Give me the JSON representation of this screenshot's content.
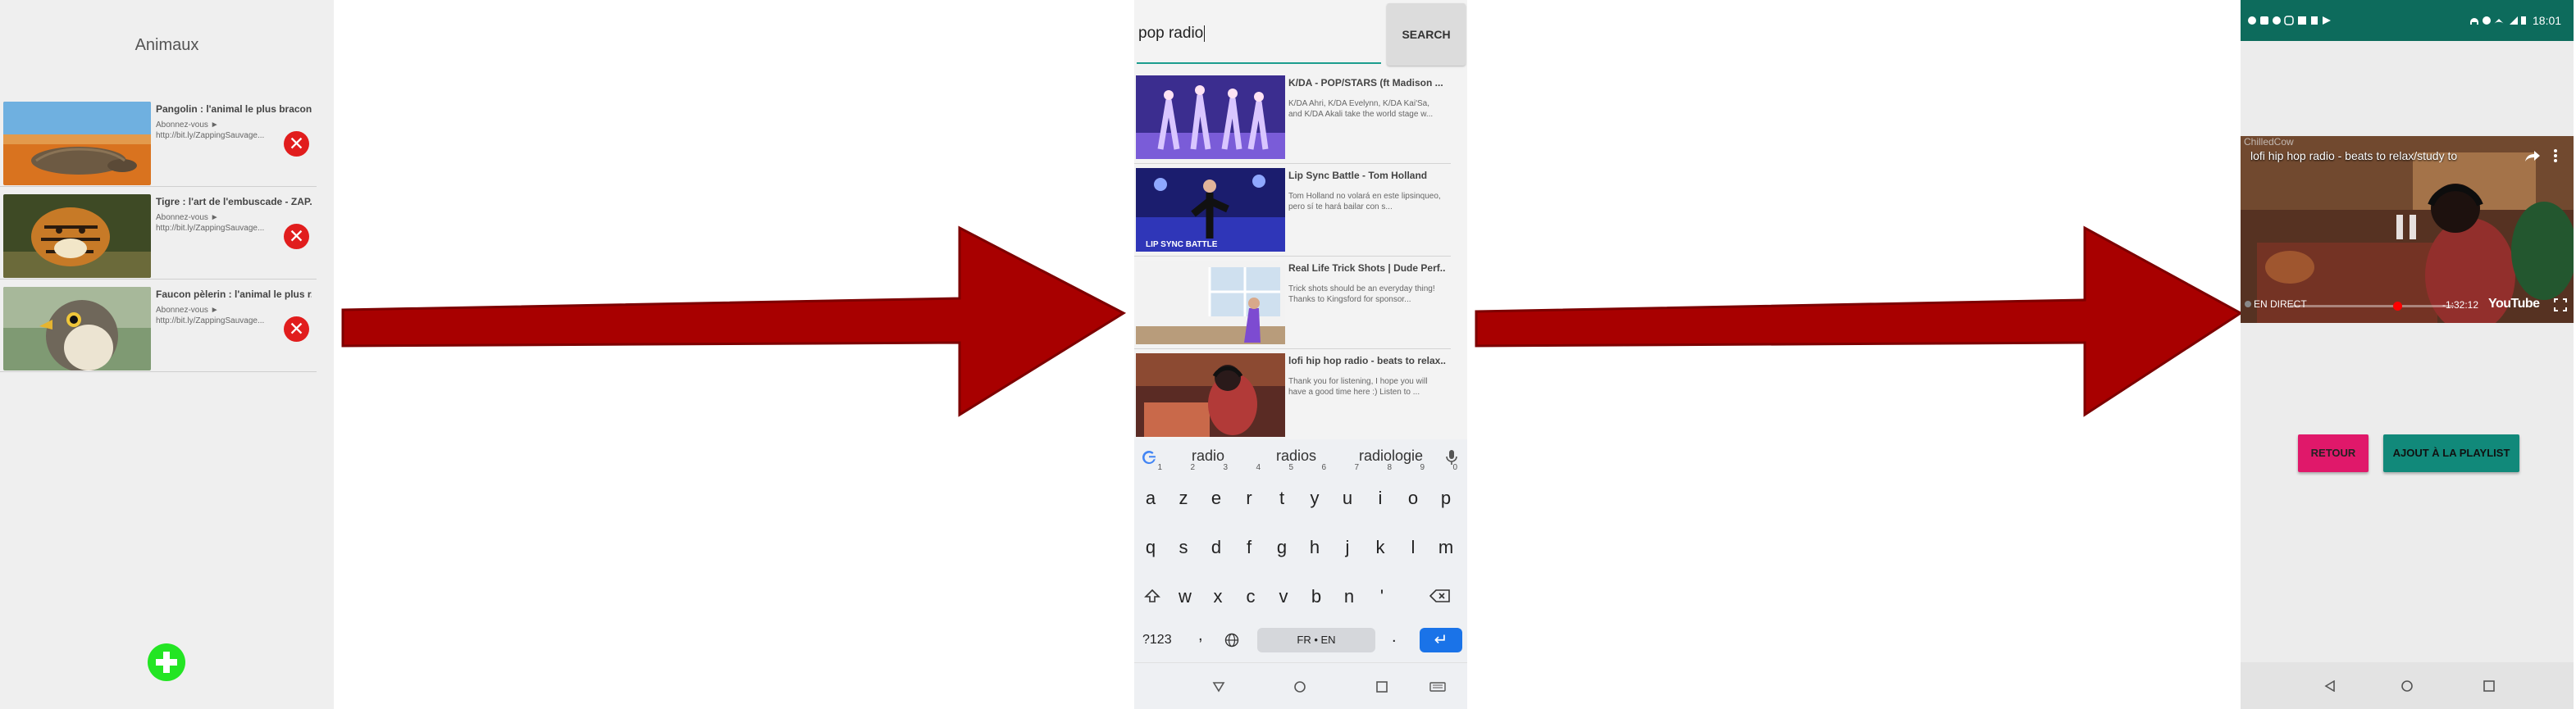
{
  "panel1": {
    "title": "Animaux",
    "videos": [
      {
        "title": "Pangolin : l'animal le plus bracon...",
        "desc": "Abonnez-vous ► http://bit.ly/ZappingSauvage..."
      },
      {
        "title": "Tigre : l'art de l'embuscade - ZAP...",
        "desc": "Abonnez-vous ► http://bit.ly/ZappingSauvage..."
      },
      {
        "title": "Faucon pèlerin : l'animal le plus r...",
        "desc": "Abonnez-vous ► http://bit.ly/ZappingSauvage..."
      }
    ],
    "delete_symbol": "✕"
  },
  "panel2": {
    "search_value": "pop radio",
    "search_button": "SEARCH",
    "results": [
      {
        "title": "K/DA - POP/STARS (ft Madison ...",
        "desc": "K/DA Ahri, K/DA Evelynn, K/DA Kai'Sa, and K/DA Akali take the world stage w..."
      },
      {
        "title": "Lip Sync Battle - Tom Holland",
        "desc": "Tom Holland no volará en este lipsinqueo, pero sí te hará bailar con s...",
        "thumb_label": "LIP SYNC BATTLE"
      },
      {
        "title": "Real Life Trick Shots | Dude Perf...",
        "desc": "Trick shots should be an everyday thing! Thanks to Kingsford for sponsor..."
      },
      {
        "title": "lofi hip hop radio - beats to relax...",
        "desc": "Thank you for listening, I hope you will have a good time here :) Listen to ..."
      }
    ],
    "suggestions": [
      "radio",
      "radios",
      "radiologie"
    ],
    "keyboard": {
      "row1": [
        "a",
        "z",
        "e",
        "r",
        "t",
        "y",
        "u",
        "i",
        "o",
        "p"
      ],
      "row1_nums": [
        "1",
        "2",
        "3",
        "4",
        "5",
        "6",
        "7",
        "8",
        "9",
        "0"
      ],
      "row2": [
        "q",
        "s",
        "d",
        "f",
        "g",
        "h",
        "j",
        "k",
        "l",
        "m"
      ],
      "row3": [
        "w",
        "x",
        "c",
        "v",
        "b",
        "n",
        "'"
      ],
      "num_key": "?123",
      "comma": ",",
      "space_label": "FR • EN",
      "period": ".",
      "enter": "↵"
    }
  },
  "panel3": {
    "clock": "18:01",
    "video_title": "lofi hip hop radio - beats to relax/study to",
    "channel": "ChilledCow",
    "live_label": "EN DIRECT",
    "time": "-1:32:12",
    "platform": "YouTube",
    "back_button": "RETOUR",
    "add_button": "AJOUT À LA PLAYLIST"
  },
  "colors": {
    "delete_red": "#e11d1d",
    "add_green": "#23e523",
    "arrow_red": "#a80000",
    "teal": "#11897a",
    "pink": "#e0186a",
    "enter_blue": "#1a73e8"
  }
}
